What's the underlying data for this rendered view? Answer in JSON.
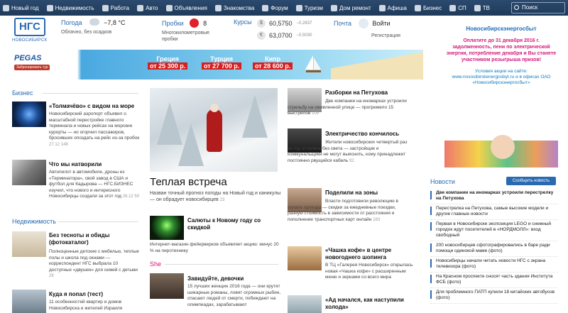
{
  "nav": {
    "items": [
      "Новый год",
      "Недвижимость",
      "Работа",
      "Авто",
      "Объявления",
      "Знакомства",
      "Форум",
      "Туризм",
      "Дом ремонт",
      "Афиша",
      "Бизнес",
      "СП",
      "ТВ"
    ],
    "search_label": "Поиск"
  },
  "header": {
    "logo_text": "НГС",
    "logo_city": "НОВОСИБИРСК",
    "weather_label": "Погода",
    "weather_value": "−7,8 °C",
    "weather_desc": "Облачно, без осадков",
    "traffic_label": "Пробки",
    "traffic_value": "8",
    "traffic_desc": "Многокилометровые пробки",
    "rates_label": "Курсы",
    "rate_usd": "60,5750",
    "rate_usd_delta": "−0,2837",
    "rate_eur": "63,0700",
    "rate_eur_delta": "−0,5030",
    "mail_label": "Почта",
    "login_label": "Войти",
    "register_label": "Регистрация"
  },
  "banner": {
    "brand": "PEGAS",
    "brand_sub": "Забронировать тур",
    "dest1": "Греция",
    "price1": "от 25 300 р.",
    "dest2": "Турция",
    "price2": "от 27 700 р.",
    "dest3": "Кипр",
    "price3": "от 28 600 р."
  },
  "business": {
    "title": "Бизнес",
    "a1_title": "«Толмачёво» с видом на море",
    "a1_text": "Новосибирский аэропорт объявил о масштабной перестройке главного терминала и новых рейсах на морские курорты — но огорчил пассажиров, бросивших опоздать на рейс из-за пробок",
    "a1_meta": "27.12  148",
    "a2_title": "Что мы натворили",
    "a2_text": "Автопилот в автомобиле, дроны из «Терминатора», свой завод в США и футбол для Кадырова — НГС.БИЗНЕС изучил, что нового и интересного Новосибирцы создали за этот год",
    "a2_meta": "26.12  50"
  },
  "realty": {
    "title": "Недвижимость",
    "a1_title": "Без тесноты и обиды (фотокаталог)",
    "a1_text": "Полноценные детские с мебелью, теплые полы и школа под окнами — корреспондент НГС выбрала 10 доступных «двушек» для семей с детьми",
    "a1_meta": "28",
    "a2_title": "Куда я попал (тест)",
    "a2_text": "11 особенностей квартир и домов Новосибирска и жителей Израиля"
  },
  "featured": {
    "title": "Теплая встреча",
    "text": "Назван точный прогноз погоды на Новый год и каникулы — он обрадует новосибирцев",
    "meta": "23",
    "sub1_title": "Салюты к Новому году со скидкой",
    "sub1_text": "Интернет-магазин фейерверков объявляет акцию: минус 20 % на пиротехнику"
  },
  "she": {
    "title": "She",
    "a1_title": "Завидуйте, девочки",
    "a1_text": "15 лучших женщин 2016 года — они крутят шикарные романы, ловят огромных рыбин, спасают людей от смерти, побеждают на олимпиадах, зарабатывают"
  },
  "col3": {
    "a1_title": "Разборки на Петухова",
    "a1_text": "Две компании на иномарках устроили стрельбу на оживленной улице — прогремело 15 выстрелов",
    "a1_meta": "109",
    "a2_title": "Электричество кончилось",
    "a2_text": "Жители новосибирских четвертый раз за год остались без света — застройщик и коммунальщики не могут выяснить, кому принадлежит постоянно рвущийся кабель",
    "a2_meta": "92",
    "a3_title": "Поделили на зоны",
    "a3_text": "Власти подготовили революцию в оплате проезда — скидки за ежедневные поездки, разную стоимость в зависимости от расстояния и пополнение транспортных карт онлайн",
    "a3_meta": "183",
    "a4_title": "«Чашка кофе» в центре новогоднего шопинга",
    "a4_text": "В ТЦ «Галерея Новосибирск» открылась новая «Чашка кофе» с расширенным меню и зернами со всего мира",
    "a5_title": "«Ад начался, как наступили холода»"
  },
  "promo": {
    "brand": "Новосибирскэнергосбыт",
    "text": "Оплатите до 31 декабря 2016 г. задолженность, пени по электрической энергии, потребление декабря и Вы станете участником розыгрыша призов!",
    "link": "Условия акции на сайте: www.novosibirskenergosbyt.ru и в офисах ОАО «Новосибирскэнергосбыт»"
  },
  "news": {
    "title": "Новости",
    "subscribe_label": "Сообщить новость",
    "items": [
      "Две компании на иномарках устроили перестрелку на Петухова",
      "Перестрелка на Петухова, самые высокие модели и другие главные новости",
      "Первая в Новосибирске экспозиция LEGO и снежный городок ждут посетителей в «НОРДМОЛЛ»: вход свободный",
      "200 новосибирцев сфотографировались в баре ради помощи одинокой маме (фото)",
      "Новосибирцы начали читать новости НГС с экрана телевизора (фото)",
      "На Красном проспекте сносят часть здания Института ФСБ (фото)",
      "Для проблемного ПАТП купили 18 китайских автобусов (фото)"
    ]
  }
}
